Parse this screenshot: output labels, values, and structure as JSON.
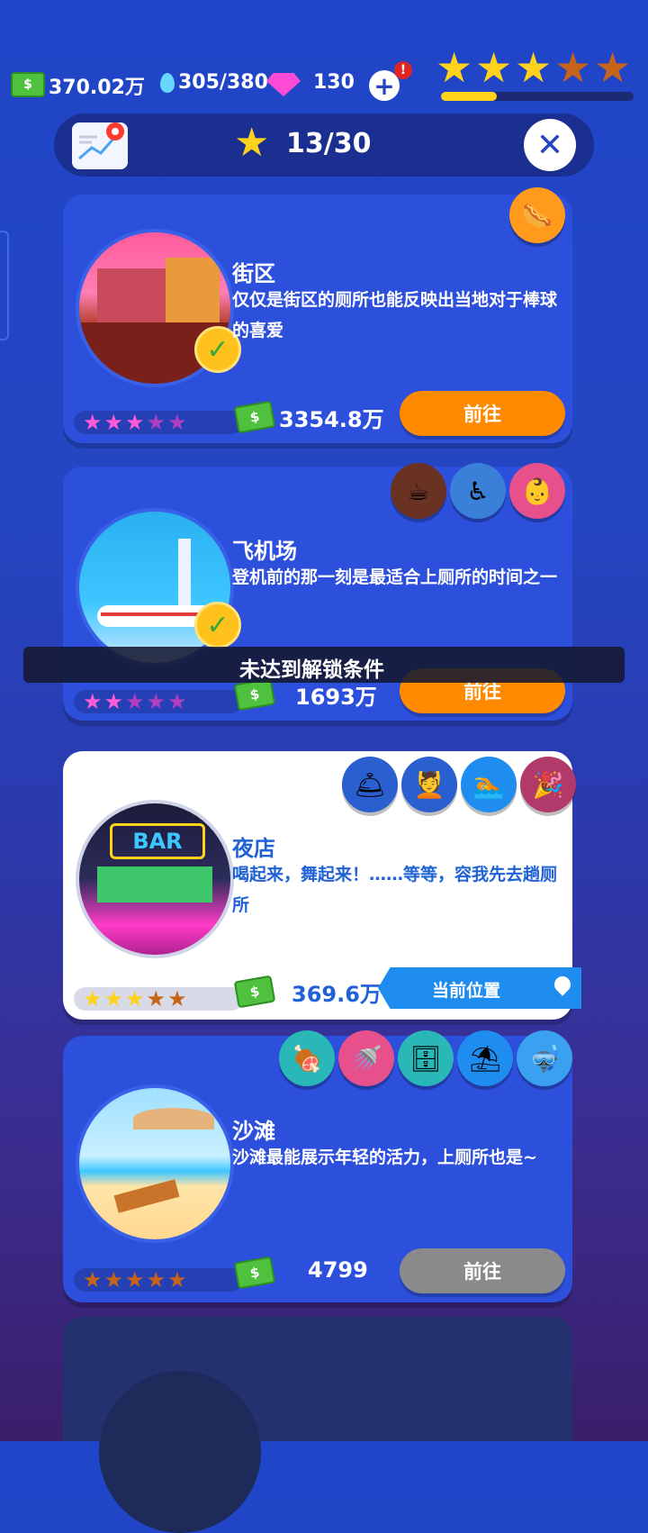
{
  "hud": {
    "money": "370.02万",
    "water": "305/380",
    "gems": "130",
    "alert": "!",
    "plus": "+",
    "level_stars_filled": 3,
    "level_stars_total": 5,
    "progress": 0.29
  },
  "header": {
    "progress_text": "13/30"
  },
  "toast": "未达到解锁条件",
  "locations": [
    {
      "title": "街区",
      "desc": "仅仅是街区的厕所也能反映出当地对于棒球的喜爱",
      "price": "3354.8万",
      "button": "前往",
      "stars_filled": 3,
      "stars_total": 5,
      "star_color": "#ff5bd8",
      "completed": true
    },
    {
      "title": "飞机场",
      "desc": "登机前的那一刻是最适合上厕所的时间之一",
      "price": "1693万",
      "button": "前往",
      "stars_filled": 2,
      "stars_total": 5,
      "star_color": "#ff5bd8",
      "completed": true
    },
    {
      "title": "夜店",
      "desc": "喝起来，舞起来！……等等，容我先去趟厕所",
      "price": "369.6万",
      "current_label": "当前位置",
      "stars_filled": 3,
      "stars_total": 5,
      "star_color": "#ffd21c",
      "current": true
    },
    {
      "title": "沙滩",
      "desc": "沙滩最能展示年轻的活力，上厕所也是~",
      "price": "4799",
      "button": "前往",
      "stars_filled": 0,
      "stars_total": 5,
      "star_color": "#ff7a1c"
    }
  ],
  "colors": {
    "card_blue": "#2c4fdc",
    "button_orange": "#ff8a00",
    "button_grey": "#8a8a8a",
    "current_blue": "#1f8cf0"
  }
}
